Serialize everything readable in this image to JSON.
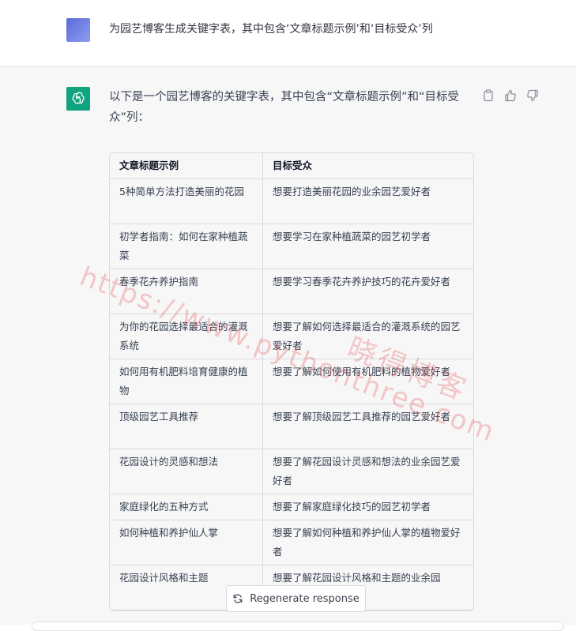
{
  "user_message": {
    "text": "为园艺博客生成关键字表，其中包含‘文章标题示例’和‘目标受众’列"
  },
  "assistant_message": {
    "intro": "以下是一个园艺博客的关键字表，其中包含“文章标题示例”和“目标受众”列：",
    "actions": {
      "copy_icon": "clipboard-icon",
      "like_icon": "thumbs-up-icon",
      "dislike_icon": "thumbs-down-icon"
    },
    "table": {
      "headers": [
        "文章标题示例",
        "目标受众"
      ],
      "rows": [
        [
          "5种简单方法打造美丽的花园",
          "想要打造美丽花园的业余园艺爱好者"
        ],
        [
          "初学者指南：如何在家种植蔬菜",
          "想要学习在家种植蔬菜的园艺初学者"
        ],
        [
          "春季花卉养护指南",
          "想要学习春季花卉养护技巧的花卉爱好者"
        ],
        [
          "为你的花园选择最适合的灌溉系统",
          "想要了解如何选择最适合的灌溉系统的园艺爱好者"
        ],
        [
          "如何用有机肥料培育健康的植物",
          "想要了解如何使用有机肥料的植物爱好者"
        ],
        [
          "顶级园艺工具推荐",
          "想要了解顶级园艺工具推荐的园艺爱好者"
        ],
        [
          "花园设计的灵感和想法",
          "想要了解花园设计灵感和想法的业余园艺爱好者"
        ],
        [
          "家庭绿化的五种方式",
          "想要了解家庭绿化技巧的园艺初学者"
        ],
        [
          "如何种植和养护仙人掌",
          "想要了解如何种植和养护仙人掌的植物爱好者"
        ],
        [
          "花园设计风格和主题",
          "想要了解花园设计风格和主题的业余园"
        ]
      ]
    }
  },
  "regenerate": {
    "label": "Regenerate response",
    "icon": "refresh-icon"
  },
  "watermark": {
    "line1": "https://www.pythonthree.com",
    "line2": "晓得博客"
  },
  "colors": {
    "assistant_bg": "#f7f7f8",
    "bot_avatar": "#10a37f",
    "watermark": "#e64646"
  }
}
